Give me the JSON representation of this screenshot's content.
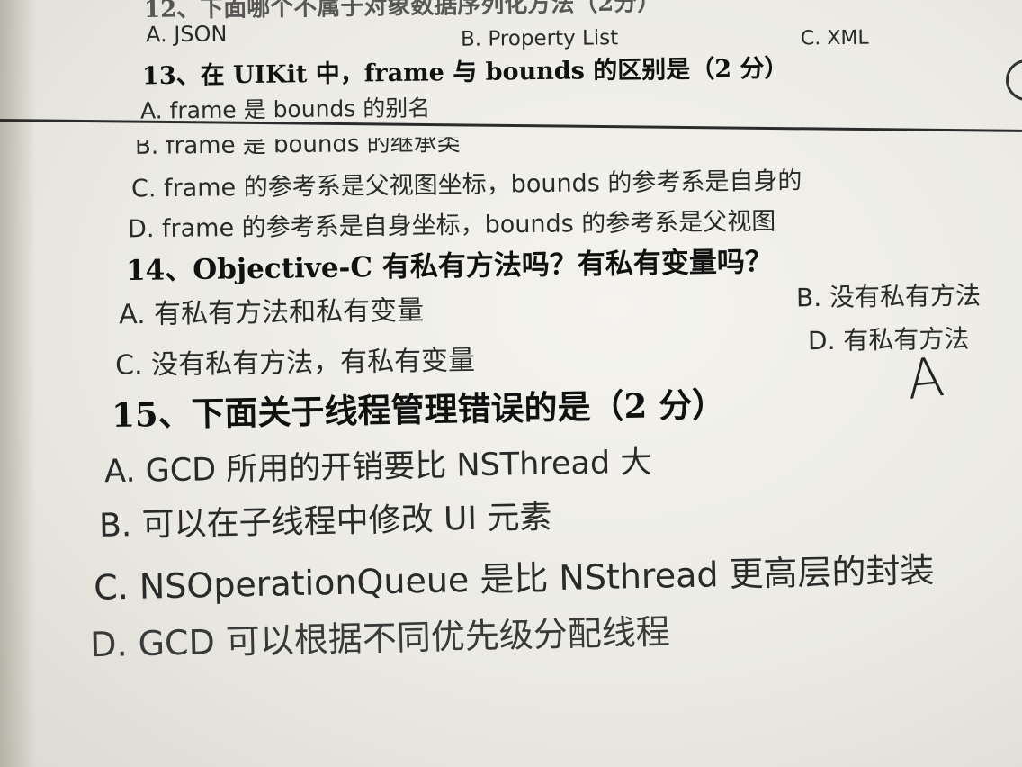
{
  "q12": {
    "title_cut": "12、下面哪个不属于对象数据序列化方法（2分）",
    "a": "A. JSON",
    "b": "B. Property List",
    "c": "C. XML"
  },
  "q13": {
    "title": "13、在 UIKit 中，frame 与 bounds 的区别是（2 分）",
    "a": "A. frame 是 bounds 的别名",
    "b": "B. frame 是 bounds 的继承类",
    "c": "C. frame 的参考系是父视图坐标，bounds 的参考系是自身的",
    "d": "D. frame 的参考系是自身坐标，bounds 的参考系是父视图"
  },
  "q14": {
    "title": "14、Objective-C 有私有方法吗？有私有变量吗？",
    "a": "A. 有私有方法和私有变量",
    "b": "B. 没有私有方法",
    "c": "C. 没有私有方法，有私有变量",
    "d": "D. 有私有方法"
  },
  "q15": {
    "title": "15、下面关于线程管理错误的是（2 分）",
    "handwritten_answer": "A",
    "a": "A. GCD 所用的开销要比 NSThread 大",
    "b": "B. 可以在子线程中修改 UI 元素",
    "c": "C. NSOperationQueue 是比 NSthread 更高层的封装",
    "d": "D. GCD 可以根据不同优先级分配线程"
  }
}
